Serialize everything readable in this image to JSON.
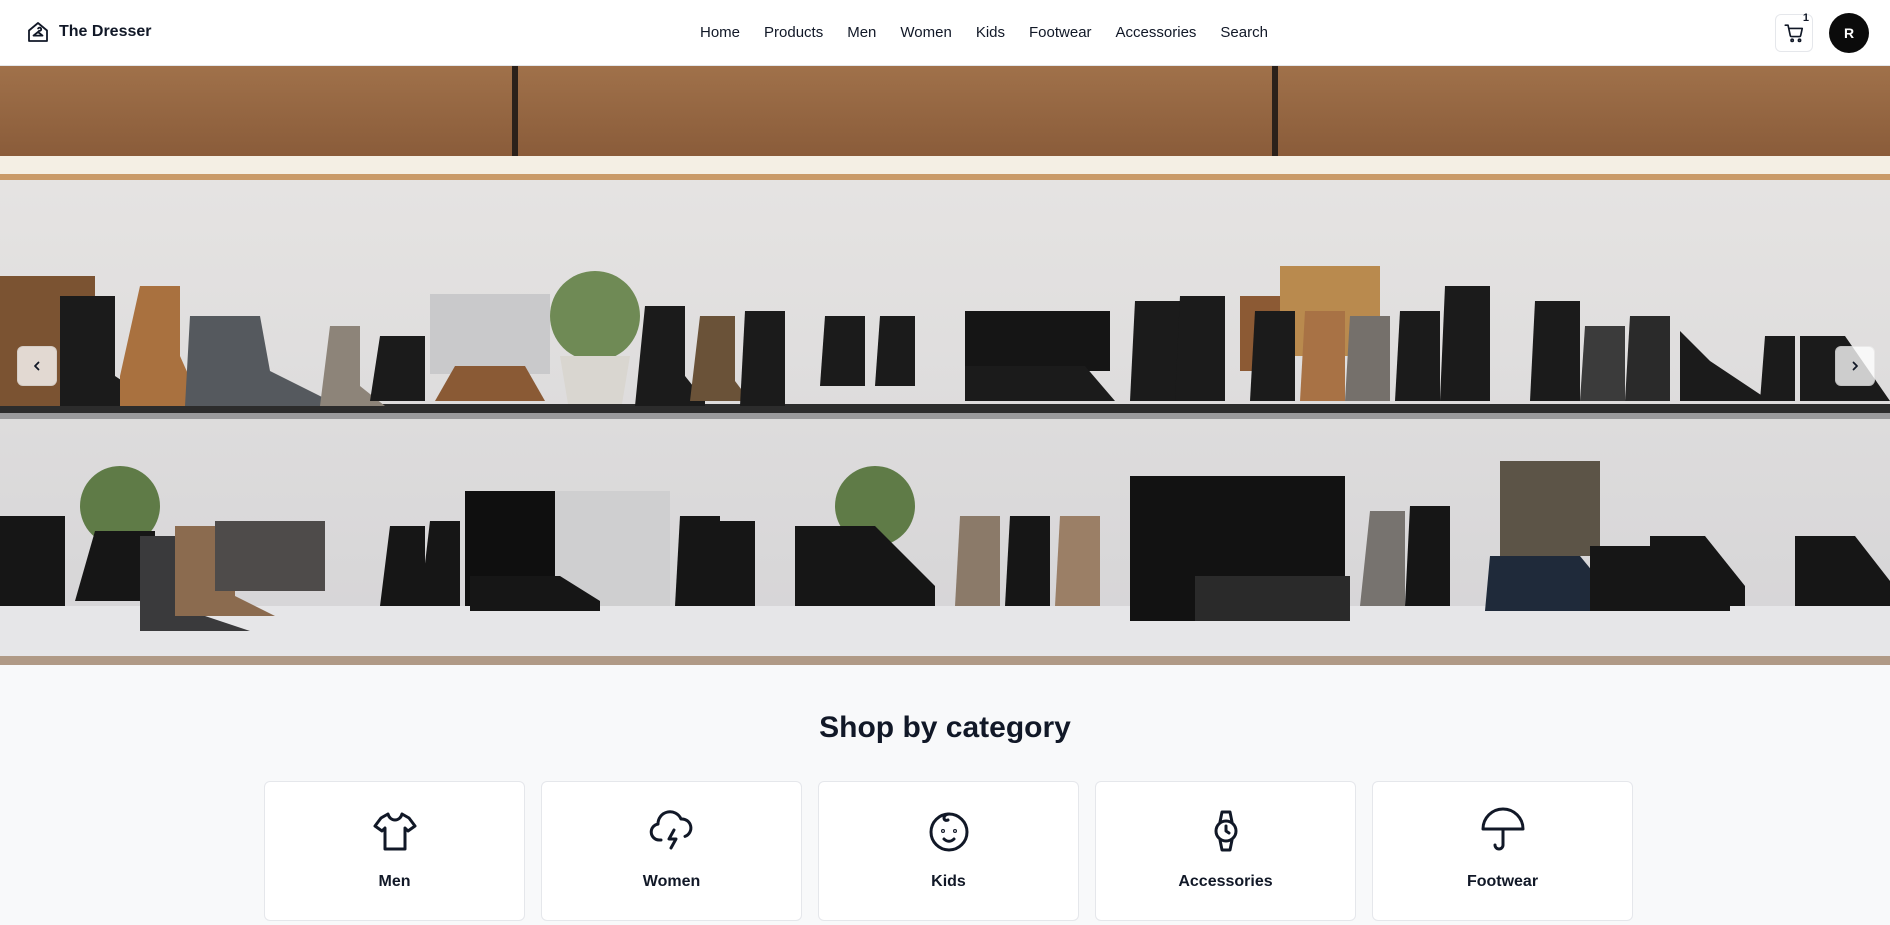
{
  "header": {
    "brand": "The Dresser",
    "nav": [
      "Home",
      "Products",
      "Men",
      "Women",
      "Kids",
      "Footwear",
      "Accessories",
      "Search"
    ],
    "cart_count": "1",
    "avatar_initial": "R"
  },
  "icons": {
    "brand": "house-hanger-icon",
    "cart": "shopping-cart-icon",
    "prev": "chevron-left-icon",
    "next": "chevron-right-icon"
  },
  "hero": {
    "description_colors": {
      "wood": "#9b6b45",
      "wall": "#dedcdc",
      "shelf": "#2a2a2a"
    }
  },
  "categories_section": {
    "title": "Shop by category",
    "items": [
      {
        "label": "Men",
        "icon": "shirt-icon"
      },
      {
        "label": "Women",
        "icon": "cloud-lightning-icon"
      },
      {
        "label": "Kids",
        "icon": "baby-face-icon"
      },
      {
        "label": "Accessories",
        "icon": "watch-icon"
      },
      {
        "label": "Footwear",
        "icon": "umbrella-icon"
      }
    ]
  }
}
